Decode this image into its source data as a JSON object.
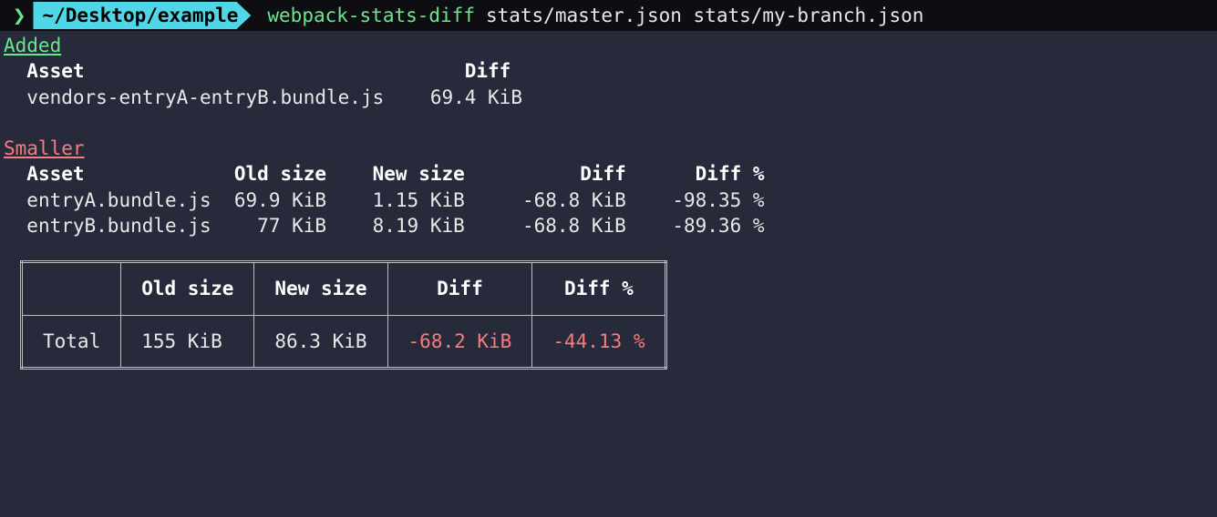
{
  "prompt": {
    "path": "~/Desktop/example",
    "command": "webpack-stats-diff",
    "args": "stats/master.json stats/my-branch.json"
  },
  "sections": {
    "added": {
      "title": "Added",
      "headers": {
        "asset": "Asset",
        "diff": "Diff"
      },
      "rows": [
        {
          "asset": "vendors-entryA-entryB.bundle.js",
          "diff": "69.4 KiB"
        }
      ]
    },
    "smaller": {
      "title": "Smaller",
      "headers": {
        "asset": "Asset",
        "old": "Old size",
        "new": "New size",
        "diff": "Diff",
        "pct": "Diff %"
      },
      "rows": [
        {
          "asset": "entryA.bundle.js",
          "old": "69.9 KiB",
          "new": "1.15 KiB",
          "diff": "-68.8 KiB",
          "pct": "-98.35 %"
        },
        {
          "asset": "entryB.bundle.js",
          "old": "77 KiB",
          "new": "8.19 KiB",
          "diff": "-68.8 KiB",
          "pct": "-89.36 %"
        }
      ]
    }
  },
  "total": {
    "headers": {
      "old": "Old size",
      "new": "New size",
      "diff": "Diff",
      "pct": "Diff %"
    },
    "label": "Total",
    "old": "155 KiB",
    "new": "86.3 KiB",
    "diff": "-68.2 KiB",
    "pct": "-44.13 %"
  }
}
